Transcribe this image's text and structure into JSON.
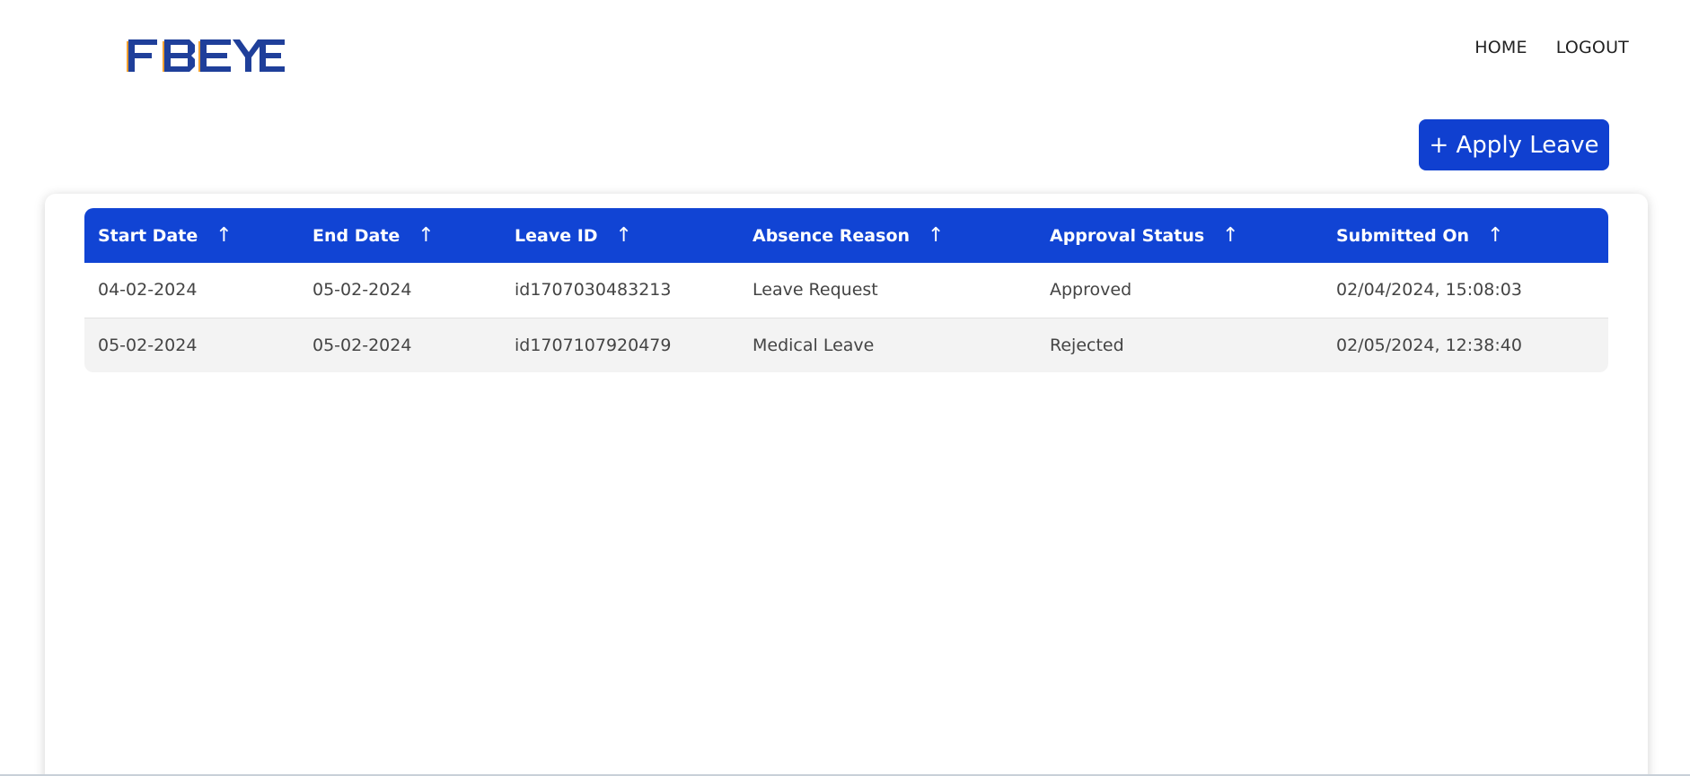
{
  "nav": {
    "home_label": "HOME",
    "logout_label": "LOGOUT"
  },
  "actions": {
    "apply_leave_label": "+ Apply Leave"
  },
  "colors": {
    "primary": "#1144d4",
    "logo_blue": "#1f3f9a",
    "logo_accent": "#f0a030",
    "row_alt": "#f3f3f3"
  },
  "table": {
    "sort_indicator": "↑",
    "columns": [
      {
        "label": "Start Date"
      },
      {
        "label": "End Date"
      },
      {
        "label": "Leave ID"
      },
      {
        "label": "Absence Reason"
      },
      {
        "label": "Approval Status"
      },
      {
        "label": "Submitted On"
      }
    ],
    "rows": [
      {
        "start_date": "04-02-2024",
        "end_date": "05-02-2024",
        "leave_id": "id1707030483213",
        "absence_reason": "Leave Request",
        "approval_status": "Approved",
        "submitted_on": "02/04/2024, 15:08:03"
      },
      {
        "start_date": "05-02-2024",
        "end_date": "05-02-2024",
        "leave_id": "id1707107920479",
        "absence_reason": "Medical Leave",
        "approval_status": "Rejected",
        "submitted_on": "02/05/2024, 12:38:40"
      }
    ]
  }
}
